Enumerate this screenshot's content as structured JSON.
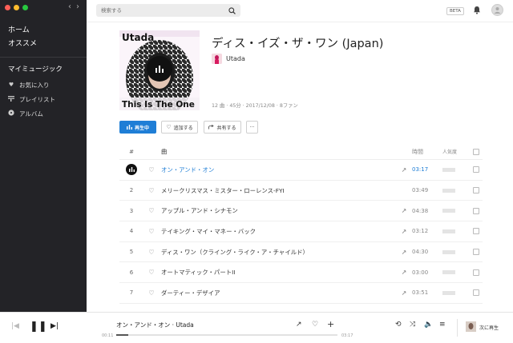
{
  "sidebar": {
    "primary": [
      "ホーム",
      "オススメ"
    ],
    "my_music_heading": "マイミュージック",
    "library": [
      {
        "label": "お気に入り",
        "icon": "heart-icon"
      },
      {
        "label": "プレイリスト",
        "icon": "playlist-icon"
      },
      {
        "label": "アルバム",
        "icon": "album-icon"
      }
    ]
  },
  "topbar": {
    "search_placeholder": "検索する",
    "beta_badge": "BETA"
  },
  "album": {
    "cover_top_text": "Utada",
    "cover_bottom_text": "This Is The One",
    "title": "ディス・イズ・ザ・ワン (Japan)",
    "artist": "Utada",
    "meta": "12 曲 · 45分 · 2017/12/08 · 8ファン"
  },
  "actions": {
    "play": "再生中",
    "add": "追加する",
    "share": "共有する",
    "more": "···"
  },
  "table": {
    "headers": {
      "num": "#",
      "title": "曲",
      "time": "時間",
      "popularity": "人気度"
    },
    "tracks": [
      {
        "num": "1",
        "title": "オン・アンド・オン",
        "time": "03:17",
        "playing": true,
        "has_link": true
      },
      {
        "num": "2",
        "title": "メリークリスマス・ミスター・ローレンス-FYI",
        "time": "03:49",
        "playing": false,
        "has_link": false
      },
      {
        "num": "3",
        "title": "アップル・アンド・シナモン",
        "time": "04:38",
        "playing": false,
        "has_link": true
      },
      {
        "num": "4",
        "title": "テイキング・マイ・マネー・バック",
        "time": "03:12",
        "playing": false,
        "has_link": true
      },
      {
        "num": "5",
        "title": "ディス・ワン（クライング・ライク・ア・チャイルド）",
        "time": "04:30",
        "playing": false,
        "has_link": true
      },
      {
        "num": "6",
        "title": "オートマティック・パートII",
        "time": "03:00",
        "playing": false,
        "has_link": true
      },
      {
        "num": "7",
        "title": "ダーティー・デザイア",
        "time": "03:51",
        "playing": false,
        "has_link": true
      }
    ]
  },
  "player": {
    "now_playing": "オン・アンド・オン · Utada",
    "elapsed": "00:11",
    "total": "03:17",
    "progress_fraction": 0.056,
    "queue_label": "次に再生"
  },
  "colors": {
    "accent": "#1f7ed6",
    "sidebar_bg": "#232327"
  }
}
